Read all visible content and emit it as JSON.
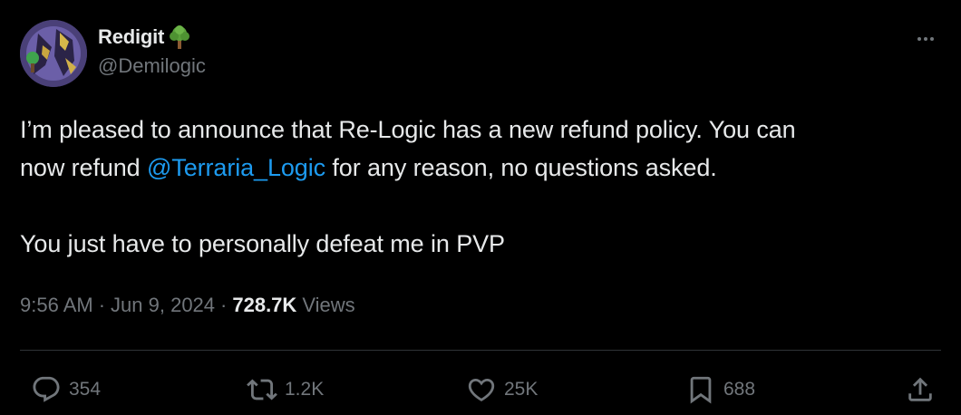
{
  "author": {
    "display_name": "Redigit",
    "handle": "@Demilogic"
  },
  "tweet": {
    "line1": "I’m pleased to announce that Re-Logic has a new refund policy. You can",
    "line2_before": "now refund ",
    "line2_mention": "@Terraria_Logic",
    "line2_after": " for any reason, no questions asked.",
    "line3": "You just have to personally defeat me in PVP"
  },
  "meta": {
    "time": "9:56 AM",
    "separator": "·",
    "date": "Jun 9, 2024",
    "views_count": "728.7K",
    "views_label": "Views"
  },
  "actions": {
    "replies": "354",
    "reposts": "1.2K",
    "likes": "25K",
    "bookmarks": "688"
  },
  "colors": {
    "background": "#000000",
    "text": "#e7e9ea",
    "muted": "#71767b",
    "link": "#1d9bf0",
    "divider": "#2f3336"
  },
  "icons": [
    "tree-emoji-icon",
    "more-icon",
    "reply-icon",
    "repost-icon",
    "like-icon",
    "bookmark-icon",
    "share-icon"
  ]
}
